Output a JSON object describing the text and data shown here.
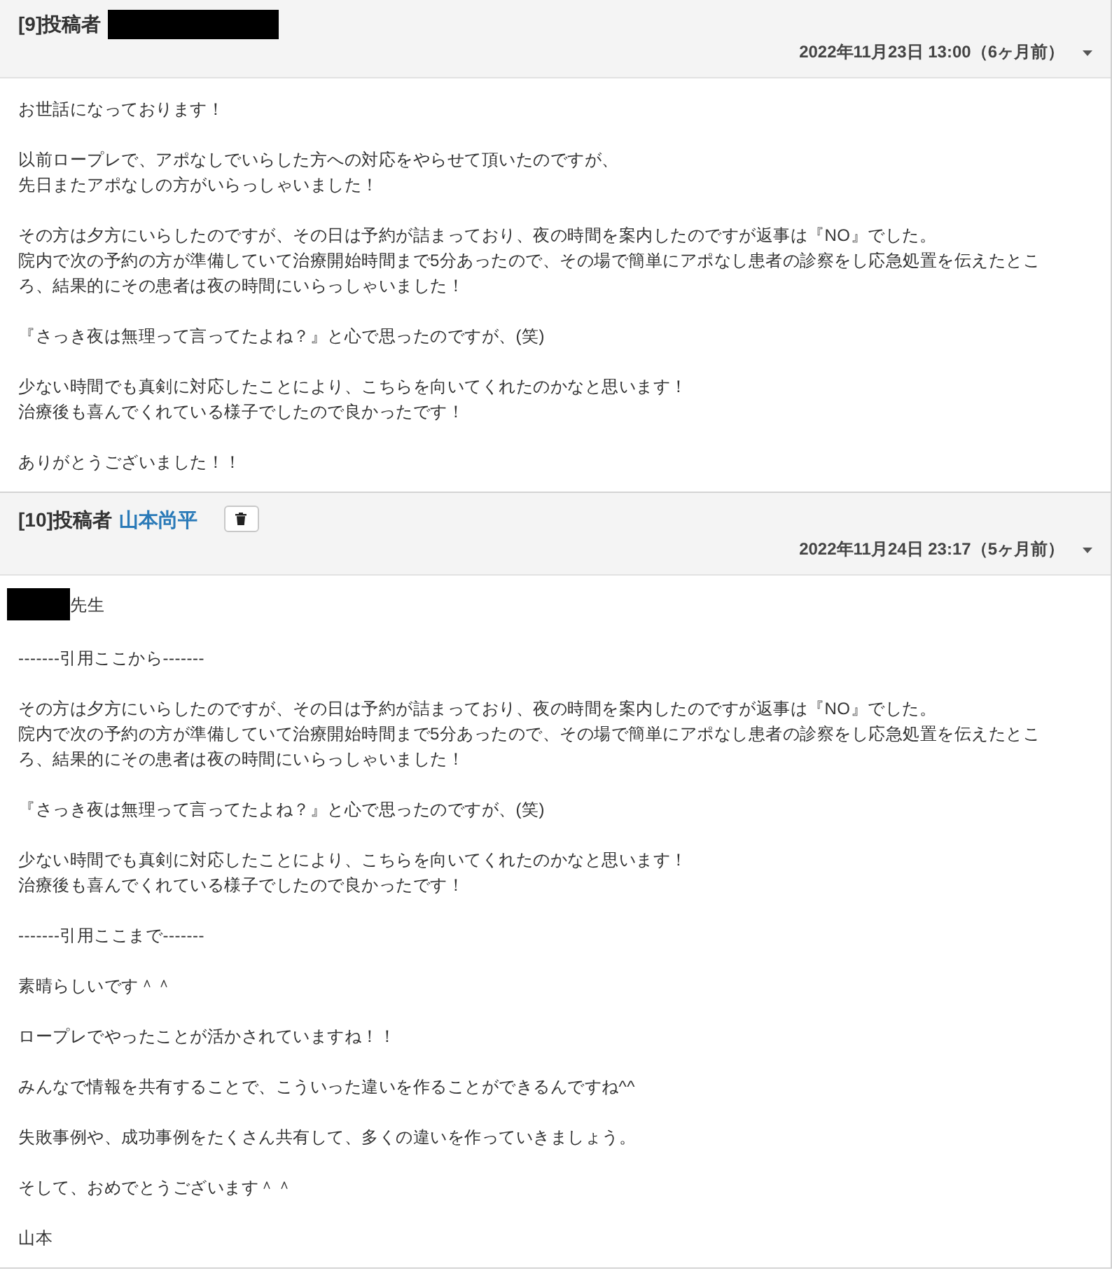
{
  "posts": [
    {
      "title": "[9]投稿者",
      "author": {
        "redacted": true
      },
      "delete_button": false,
      "date": "2022年11月23日 13:00（6ヶ月前）",
      "body": [
        [
          "お世話になっております！"
        ],
        [
          "以前ロープレで、アポなしでいらした方への対応をやらせて頂いたのですが、",
          "先日またアポなしの方がいらっしゃいました！"
        ],
        [
          "その方は夕方にいらしたのですが、その日は予約が詰まっており、夜の時間を案内したのですが返事は『NO』でした。",
          "院内で次の予約の方が準備していて治療開始時間まで5分あったので、その場で簡単にアポなし患者の診察をし応急処置を伝えたところ、結果的にその患者は夜の時間にいらっしゃいました！"
        ],
        [
          "『さっき夜は無理って言ってたよね？』と心で思ったのですが、(笑)"
        ],
        [
          "少ない時間でも真剣に対応したことにより、こちらを向いてくれたのかなと思います！",
          "治療後も喜んでくれている様子でしたので良かったです！"
        ],
        [
          "ありがとうございました！！"
        ]
      ]
    },
    {
      "title": "[10]投稿者",
      "author": {
        "name": "山本尚平",
        "redacted": false
      },
      "delete_button": true,
      "date": "2022年11月24日 23:17（5ヶ月前）",
      "salutation": {
        "redacted": true,
        "text": "先生"
      },
      "body": [
        [
          "-------引用ここから-------"
        ],
        [
          "その方は夕方にいらしたのですが、その日は予約が詰まっており、夜の時間を案内したのですが返事は『NO』でした。",
          "院内で次の予約の方が準備していて治療開始時間まで5分あったので、その場で簡単にアポなし患者の診察をし応急処置を伝えたところ、結果的にその患者は夜の時間にいらっしゃいました！"
        ],
        [
          "『さっき夜は無理って言ってたよね？』と心で思ったのですが、(笑)"
        ],
        [
          "少ない時間でも真剣に対応したことにより、こちらを向いてくれたのかなと思います！",
          "治療後も喜んでくれている様子でしたので良かったです！"
        ],
        [
          "-------引用ここまで-------"
        ],
        [
          "素晴らしいです＾＾"
        ],
        [
          "ロープレでやったことが活かされていますね！！"
        ],
        [
          "みんなで情報を共有することで、こういった違いを作ることができるんですね^^"
        ],
        [
          "失敗事例や、成功事例をたくさん共有して、多くの違いを作っていきましょう。"
        ],
        [
          "そして、おめでとうございます＾＾"
        ],
        [
          "山本"
        ]
      ]
    }
  ]
}
